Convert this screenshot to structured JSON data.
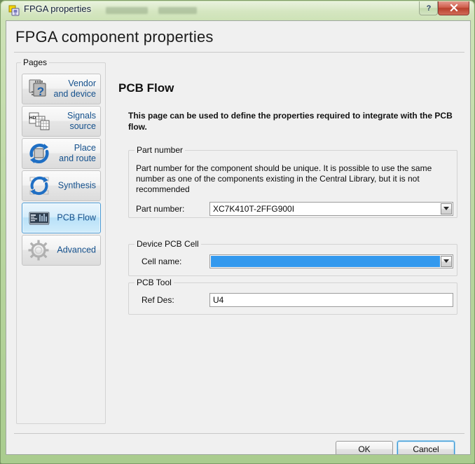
{
  "window": {
    "title": "FPGA properties",
    "icon": "fpga-properties-icon",
    "controls": [
      {
        "name": "help-button",
        "glyph": "?"
      },
      {
        "name": "close-button",
        "glyph": "x"
      }
    ]
  },
  "header": {
    "title": "FPGA component properties"
  },
  "sidebar": {
    "legend": "Pages",
    "items": [
      {
        "label": "Vendor\nand device",
        "icon": "vendor-device-icon",
        "selected": false
      },
      {
        "label": "Signals\nsource",
        "icon": "signals-source-icon",
        "selected": false
      },
      {
        "label": "Place\nand route",
        "icon": "place-and-route-icon",
        "selected": false
      },
      {
        "label": "Synthesis",
        "icon": "synthesis-icon",
        "selected": false
      },
      {
        "label": "PCB Flow",
        "icon": "pcb-flow-icon",
        "selected": true
      },
      {
        "label": "Advanced",
        "icon": "advanced-gear-icon",
        "selected": false
      }
    ]
  },
  "main": {
    "pane_title": "PCB Flow",
    "intro": "This page can be used to define the properties required to integrate with the PCB flow.",
    "part_number_group": {
      "legend": "Part number",
      "description": "Part number for the component should be unique. It is possible to use the same number as one of the components existing in the Central Library, but it is not recommended",
      "field_label": "Part number:",
      "field_value": "XC7K410T-2FFG900I",
      "field_placeholder": ""
    },
    "device_pcb_cell_group": {
      "legend": "Device PCB Cell",
      "field_label": "Cell name:",
      "field_value": "",
      "field_placeholder": "",
      "selection_color": "#3399ee"
    },
    "pcb_tool_group": {
      "legend": "PCB Tool",
      "field_label": "Ref Des:",
      "field_value": "U4",
      "field_placeholder": ""
    }
  },
  "footer": {
    "ok_label": "OK",
    "cancel_label": "Cancel"
  },
  "theme": {
    "frame": "#b6d49c",
    "dialog_bg": "#f0f0f0",
    "link_blue": "#14508c",
    "accent": "#3399ee",
    "focus_border": "#3c98d4"
  }
}
